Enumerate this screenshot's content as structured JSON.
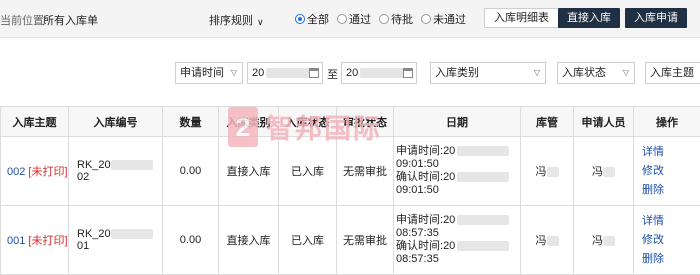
{
  "topbar": {
    "location_label": "当前位置:",
    "location_value": "所有入库单",
    "sort_label": "排序规则",
    "radios": [
      {
        "label": "全部",
        "checked": true
      },
      {
        "label": "通过",
        "checked": false
      },
      {
        "label": "待批",
        "checked": false
      },
      {
        "label": "未通过",
        "checked": false
      }
    ],
    "buttons": {
      "detail_table": "入库明细表",
      "direct_stock_in": "直接入库",
      "stock_in_request": "入库申请"
    }
  },
  "filters": {
    "time_type": "申请时间",
    "date_from": "20",
    "to_label": "至",
    "date_to": "20",
    "stock_in_type": "入库类别",
    "stock_in_status": "入库状态",
    "stock_in_theme": "入库主题"
  },
  "table": {
    "headers": [
      "入库主题",
      "入库编号",
      "数量",
      "入库类别",
      "入库状态",
      "审批状态",
      "日期",
      "库管",
      "申请人员",
      "操作"
    ],
    "rows": [
      {
        "theme_id": "002",
        "print_status": "[未打印]",
        "number_prefix": "RK_20",
        "number_suffix": "02",
        "quantity": "0.00",
        "category": "直接入库",
        "status": "已入库",
        "approval": "无需审批",
        "apply_label": "申请时间:",
        "apply_year": "20",
        "apply_time": "09:01:50",
        "confirm_label": "确认时间:",
        "confirm_year": "20",
        "confirm_time": "09:01:50",
        "keeper": "冯",
        "applicant": "冯",
        "ops": [
          "详情",
          "修改",
          "删除"
        ]
      },
      {
        "theme_id": "001",
        "print_status": "[未打印]",
        "number_prefix": "RK_20",
        "number_suffix": "01",
        "quantity": "0.00",
        "category": "直接入库",
        "status": "已入库",
        "approval": "无需审批",
        "apply_label": "申请时间:",
        "apply_year": "20",
        "apply_time": "08:57:35",
        "confirm_label": "确认时间:",
        "confirm_year": "20",
        "confirm_time": "08:57:35",
        "keeper": "冯",
        "applicant": "冯",
        "ops": [
          "详情",
          "修改",
          "删除"
        ]
      }
    ]
  },
  "watermark": {
    "logo_char": "2",
    "brand": "智邦国际"
  }
}
